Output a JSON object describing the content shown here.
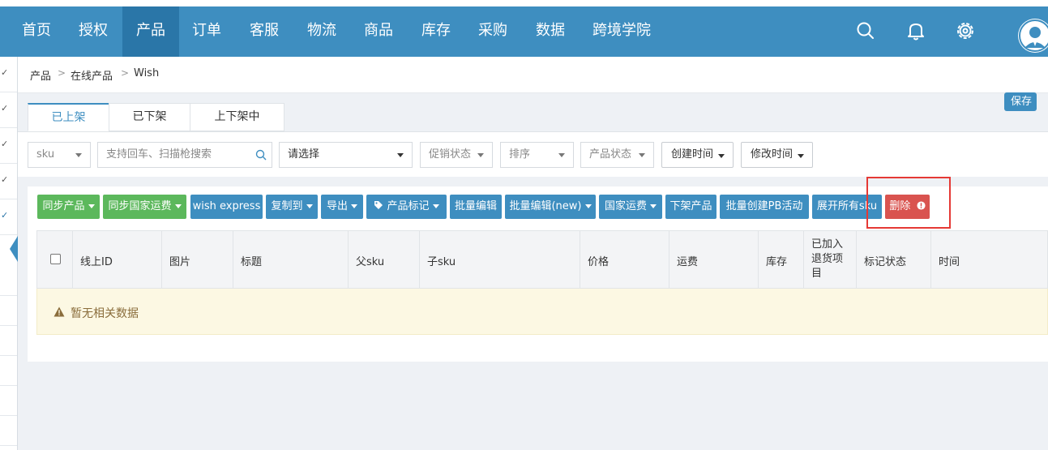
{
  "nav": {
    "items": [
      "首页",
      "授权",
      "产品",
      "订单",
      "客服",
      "物流",
      "商品",
      "库存",
      "采购",
      "数据",
      "跨境学院"
    ],
    "active_index": 2
  },
  "icons": {
    "search": "search-icon",
    "bell": "bell-icon",
    "settings": "gear-icon",
    "avatar": "avatar-icon"
  },
  "colors": {
    "nav_bg": "#3e8ec0",
    "nav_active": "#2a76a8",
    "green": "#5cb85c",
    "blue": "#3e8ec0",
    "red": "#d9534f",
    "empty_bg": "#fcf8e3"
  },
  "sidebar": {
    "checks": [
      "✓",
      "✓",
      "✓",
      "✓",
      "✓"
    ]
  },
  "breadcrumb": {
    "items": [
      "产品",
      "在线产品",
      "Wish"
    ],
    "sep": ">"
  },
  "tabs": [
    "已上架",
    "已下架",
    "上下架中"
  ],
  "filters": {
    "sku_select": "sku",
    "search_placeholder": "支持回车、扫描枪搜索",
    "category_select": "请选择",
    "promo_status": "促销状态",
    "sort": "排序",
    "product_status": "产品状态",
    "created_time": "创建时间",
    "modified_time": "修改时间",
    "save": "保存"
  },
  "actions": {
    "sync_product": "同步产品",
    "sync_shipping": "同步国家运费",
    "wish_express": "wish express",
    "copy_to": "复制到",
    "export": "导出",
    "product_mark": "产品标记",
    "batch_edit": "批量编辑",
    "batch_edit_new": "批量编辑(new)",
    "country_shipping": "国家运费",
    "delist": "下架产品",
    "batch_pb": "批量创建PB活动",
    "expand_sku": "展开所有sku",
    "delete": "删除"
  },
  "table": {
    "columns": [
      "线上ID",
      "图片",
      "标题",
      "父sku",
      "子sku",
      "价格",
      "运费",
      "库存",
      "已加入退货项目",
      "标记状态",
      "时间"
    ],
    "empty_message": "暂无相关数据"
  }
}
